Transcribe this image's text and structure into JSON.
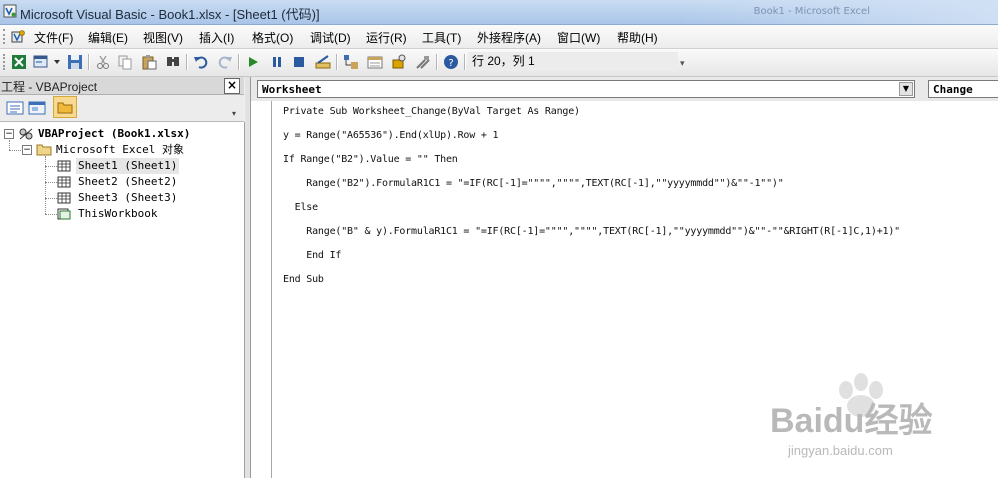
{
  "window": {
    "title": "Microsoft Visual Basic - Book1.xlsx - [Sheet1 (代码)]",
    "background_title": "Book1 - Microsoft Excel"
  },
  "menu": {
    "items": [
      "文件(F)",
      "编辑(E)",
      "视图(V)",
      "插入(I)",
      "格式(O)",
      "调试(D)",
      "运行(R)",
      "工具(T)",
      "外接程序(A)",
      "窗口(W)",
      "帮助(H)"
    ]
  },
  "toolbar": {
    "cursor_position": "行 20，列 1",
    "icons": [
      "excel-view-icon",
      "insert-userform-icon",
      "save-icon",
      "cut-icon",
      "copy-icon",
      "paste-icon",
      "find-icon",
      "undo-icon",
      "redo-icon",
      "run-icon",
      "break-icon",
      "reset-icon",
      "design-mode-icon",
      "project-explorer-icon",
      "properties-icon",
      "object-browser-icon",
      "toolbox-icon",
      "help-icon"
    ]
  },
  "project": {
    "title": "工程 - VBAProject",
    "close_label": "×",
    "root": "VBAProject (Book1.xlsx)",
    "folder": "Microsoft Excel 对象",
    "sheets": [
      "Sheet1 (Sheet1)",
      "Sheet2 (Sheet2)",
      "Sheet3 (Sheet3)"
    ],
    "workbook": "ThisWorkbook"
  },
  "code": {
    "object": "Worksheet",
    "procedure": "Change",
    "lines": [
      "Private Sub Worksheet_Change(ByVal Target As Range)",
      "y = Range(\"A65536\").End(xlUp).Row + 1",
      "If Range(\"B2\").Value = \"\" Then",
      "    Range(\"B2\").FormulaR1C1 = \"=IF(RC[-1]=\"\"\"\",\"\"\"\",TEXT(RC[-1],\"\"yyyymmdd\"\")&\"\"-1\"\")\"",
      "  Else",
      "    Range(\"B\" & y).FormulaR1C1 = \"=IF(RC[-1]=\"\"\"\",\"\"\"\",TEXT(RC[-1],\"\"yyyymmdd\"\")&\"\"-\"\"&RIGHT(R[-1]C,1)+1)\"",
      "    End If",
      "End Sub"
    ]
  },
  "watermark": {
    "brand": "Baidu经验",
    "url": "jingyan.baidu.com"
  }
}
